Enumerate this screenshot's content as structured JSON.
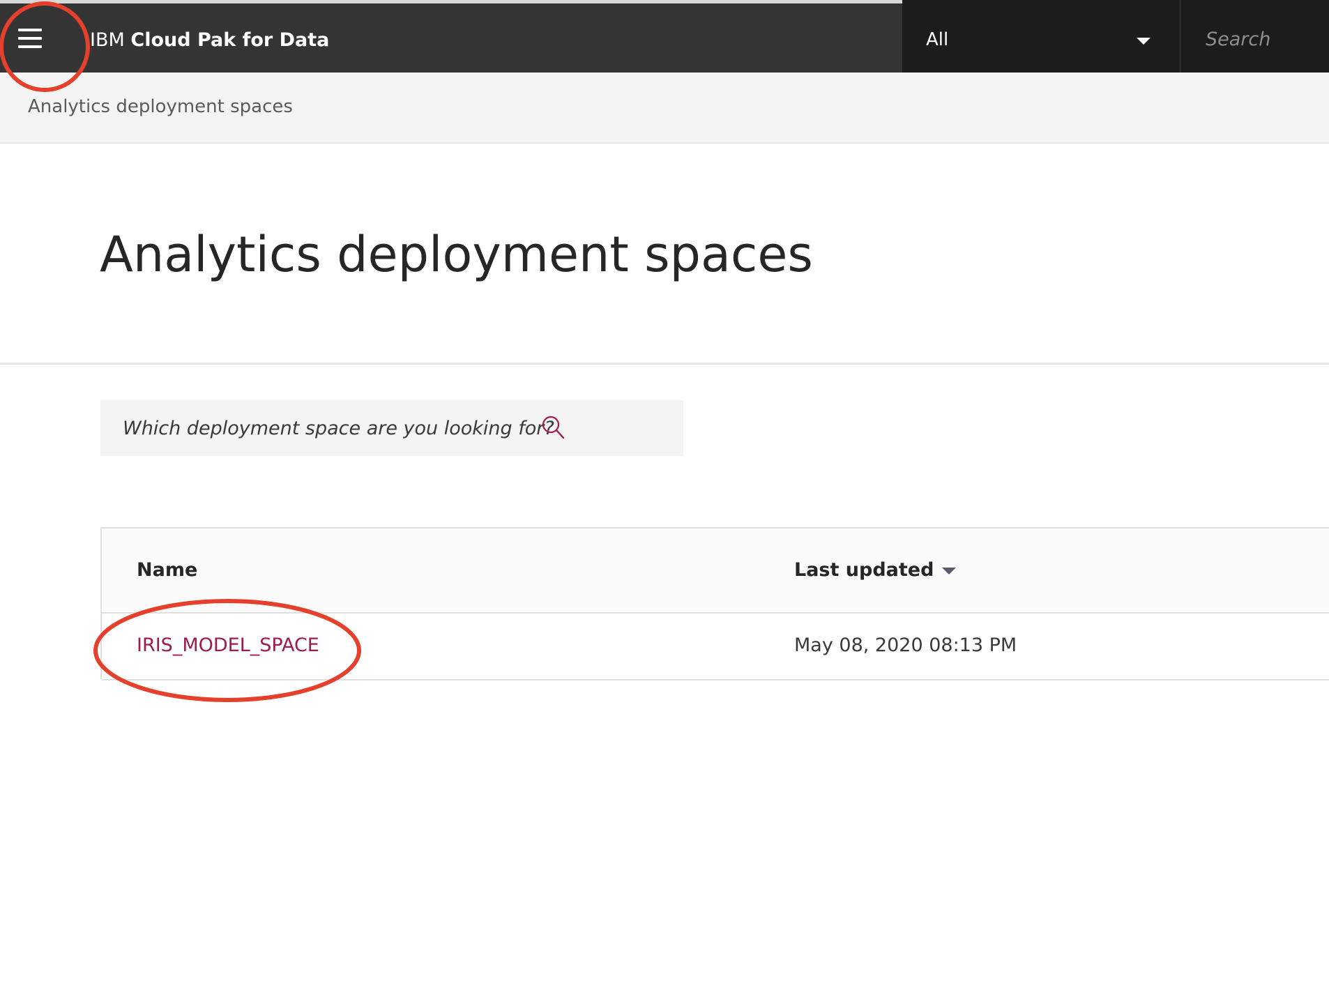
{
  "header": {
    "brand_prefix": "IBM",
    "brand_name": "Cloud Pak for Data",
    "scope_value": "All",
    "search_placeholder": "Search"
  },
  "breadcrumb": {
    "current": "Analytics deployment spaces"
  },
  "page": {
    "title": "Analytics deployment spaces"
  },
  "filter": {
    "placeholder": "Which deployment space are you looking for?"
  },
  "table": {
    "columns": [
      "Name",
      "Last updated"
    ],
    "sort_column": "Last updated",
    "rows": [
      {
        "name": "IRIS_MODEL_SPACE",
        "last_updated": "May 08, 2020 08:13 PM"
      }
    ]
  },
  "colors": {
    "topbar": "#343434",
    "dropdown_bg": "#1c1c1c",
    "link": "#9e1a4f",
    "annotation": "#e5402b"
  }
}
